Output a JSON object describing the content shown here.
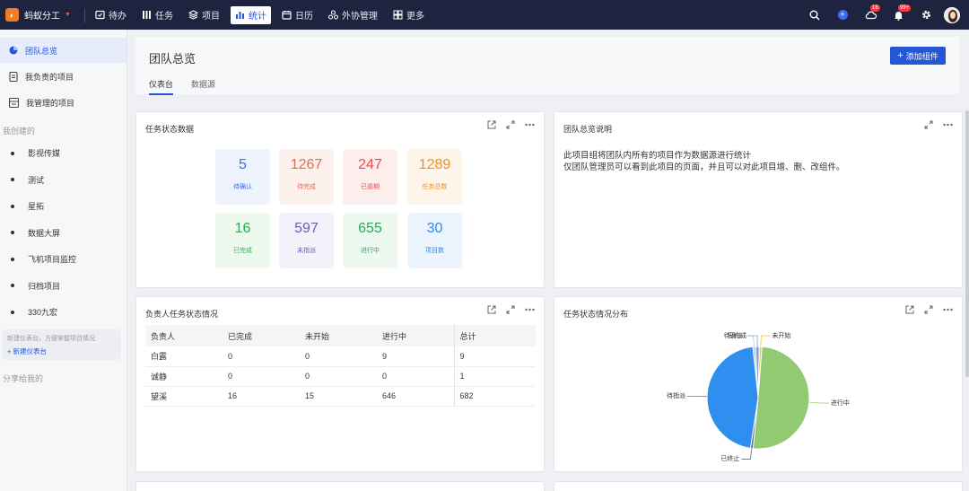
{
  "app": {
    "name": "蚂蚁分工"
  },
  "nav": [
    {
      "label": "待办",
      "icon": "todo-icon"
    },
    {
      "label": "任务",
      "icon": "task-icon"
    },
    {
      "label": "项目",
      "icon": "project-icon"
    },
    {
      "label": "统计",
      "icon": "stats-icon",
      "active": true
    },
    {
      "label": "日历",
      "icon": "calendar-icon"
    },
    {
      "label": "外协管理",
      "icon": "outsource-icon"
    },
    {
      "label": "更多",
      "icon": "more-icon"
    }
  ],
  "topright": {
    "badge_1": "18",
    "badge_2": "99+"
  },
  "sidebar": {
    "items": [
      {
        "label": "团队总览",
        "icon": "pie-icon",
        "active": true
      },
      {
        "label": "我负责的项目",
        "icon": "doc-icon"
      },
      {
        "label": "我管理的项目",
        "icon": "manage-icon"
      }
    ],
    "created_title": "我创建的",
    "projects": [
      "影视传媒",
      "测试",
      "星拓",
      "数据大屏",
      "飞机项目监控",
      "归档项目",
      "330九宏"
    ],
    "hint": "新建仪表台，方便掌握项目情况",
    "new_dashboard": "+ 新建仪表台",
    "shared_title": "分享给我的"
  },
  "header": {
    "title": "团队总览",
    "tabs": [
      "仪表台",
      "数据源"
    ],
    "add_button": "添加组件"
  },
  "status_card": {
    "title": "任务状态数据",
    "stats": [
      {
        "value": "5",
        "label": "待确认",
        "color": "#3a6cf0",
        "bg": "#eef3fd"
      },
      {
        "value": "1267",
        "label": "待完成",
        "color": "#e56a4f",
        "bg": "#fdf1ee"
      },
      {
        "value": "247",
        "label": "已逾期",
        "color": "#ec4b4b",
        "bg": "#fdeeee"
      },
      {
        "value": "1289",
        "label": "任务总数",
        "color": "#f0902a",
        "bg": "#fdf4ea"
      },
      {
        "value": "16",
        "label": "已完成",
        "color": "#34a853",
        "bg": "#edf8ef"
      },
      {
        "value": "597",
        "label": "未指派",
        "color": "#6b5fb5",
        "bg": "#f3f1fa"
      },
      {
        "value": "655",
        "label": "进行中",
        "color": "#2fa55a",
        "bg": "#ecf8f0"
      },
      {
        "value": "30",
        "label": "项目数",
        "color": "#2d8cf0",
        "bg": "#ecf5fe"
      }
    ]
  },
  "desc_card": {
    "title": "团队总览说明",
    "lines": [
      "此项目组将团队内所有的项目作为数据源进行统计",
      "仅团队管理员可以看到此项目的页面，并且可以对此项目增、删、改组件。"
    ]
  },
  "table_card": {
    "title": "负责人任务状态情况",
    "columns": [
      "负责人",
      "已完成",
      "未开始",
      "进行中",
      "总计"
    ],
    "rows": [
      [
        "白露",
        "0",
        "0",
        "9",
        "9"
      ],
      [
        "诚静",
        "0",
        "0",
        "0",
        "1"
      ],
      [
        "望溪",
        "16",
        "15",
        "646",
        "682"
      ]
    ]
  },
  "pie_card": {
    "title": "任务状态情况分布",
    "chart_data": {
      "type": "pie",
      "slices": [
        {
          "label": "待确认",
          "value": 5,
          "color": "#b5c7e8"
        },
        {
          "label": "已完成",
          "value": 16,
          "color": "#7ea3d9"
        },
        {
          "label": "未开始",
          "value": 0,
          "color": "#f4c542"
        },
        {
          "label": "进行中",
          "value": 655,
          "color": "#92c973"
        },
        {
          "label": "已终止",
          "value": 0,
          "color": "#5b6f8a"
        },
        {
          "label": "待指派",
          "value": 597,
          "color": "#2f8ff0"
        }
      ]
    }
  }
}
